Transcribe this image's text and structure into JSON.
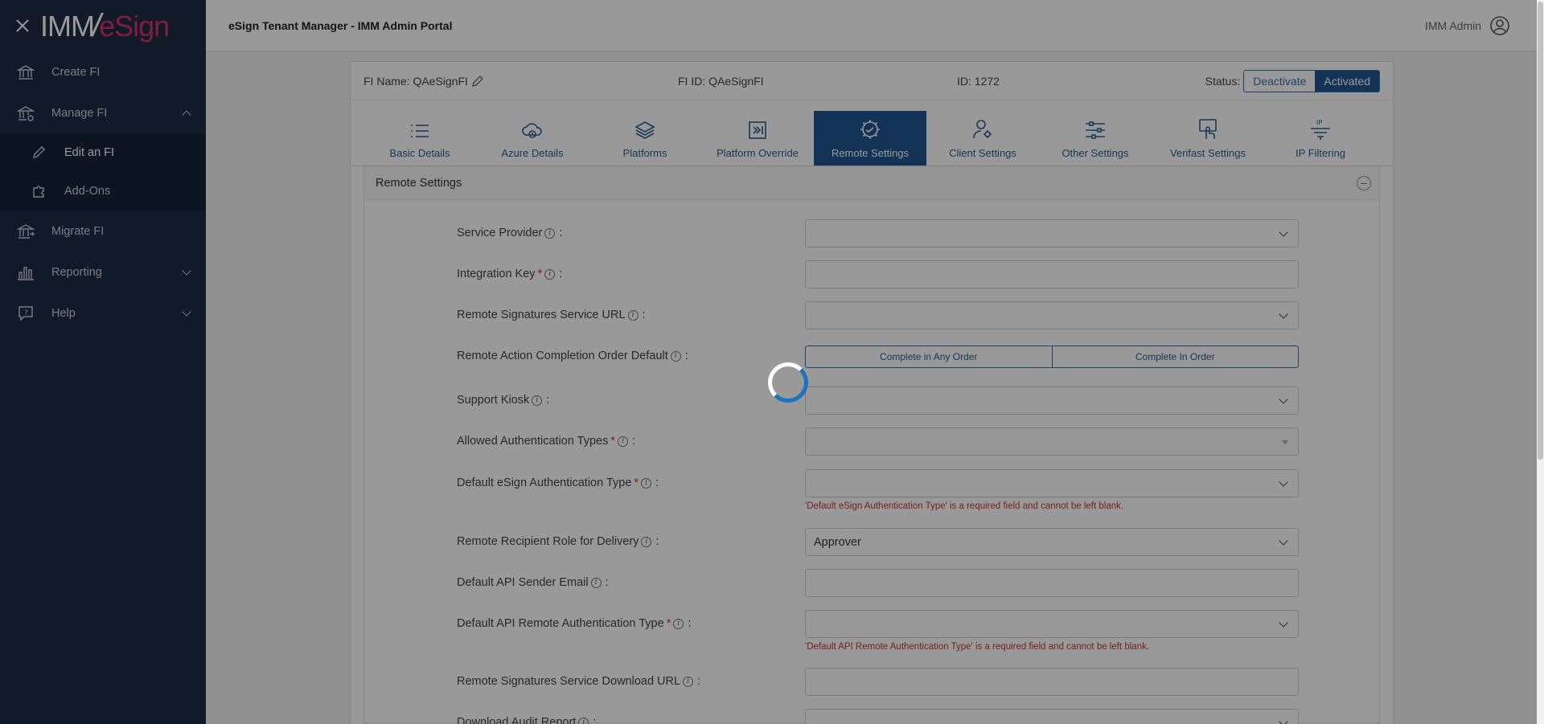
{
  "logo": {
    "part1": "IMM",
    "slash": "/",
    "part2": "eSign"
  },
  "sidebar": {
    "items": [
      {
        "label": "Create FI",
        "icon": "bank-icon"
      },
      {
        "label": "Manage FI",
        "icon": "bank-gear-icon",
        "expanded": true,
        "children": [
          {
            "label": "Edit an FI",
            "icon": "pencil-icon"
          },
          {
            "label": "Add-Ons",
            "icon": "puzzle-icon"
          }
        ]
      },
      {
        "label": "Migrate FI",
        "icon": "bank-arrow-icon"
      },
      {
        "label": "Reporting",
        "icon": "bar-chart-icon",
        "expanded": false
      },
      {
        "label": "Help",
        "icon": "help-bubble-icon",
        "expanded": false
      }
    ]
  },
  "header": {
    "title": "eSign Tenant Manager - IMM Admin Portal",
    "user": "IMM Admin"
  },
  "fi": {
    "name_label": "FI Name: QAeSignFI",
    "id_label": "FI ID: QAeSignFI",
    "num_id_label": "ID: 1272",
    "status_label": "Status:",
    "deactivate": "Deactivate",
    "activated": "Activated"
  },
  "tabs": [
    {
      "label": "Basic Details",
      "icon": "list-icon"
    },
    {
      "label": "Azure Details",
      "icon": "cloud-icon"
    },
    {
      "label": "Platforms",
      "icon": "layers-icon"
    },
    {
      "label": "Platform Override",
      "icon": "override-icon"
    },
    {
      "label": "Remote Settings",
      "icon": "remote-gear-icon",
      "active": true
    },
    {
      "label": "Client Settings",
      "icon": "user-gear-icon"
    },
    {
      "label": "Other Settings",
      "icon": "sliders-icon"
    },
    {
      "label": "Verifast Settings",
      "icon": "hand-touch-icon"
    },
    {
      "label": "IP Filtering",
      "icon": "ip-filter-icon"
    }
  ],
  "section": {
    "title": "Remote Settings"
  },
  "form": {
    "service_provider": {
      "label": "Service Provider",
      "value": ""
    },
    "integration_key": {
      "label": "Integration Key",
      "value": ""
    },
    "remote_sig_url": {
      "label": "Remote Signatures Service URL",
      "value": ""
    },
    "completion_order": {
      "label": "Remote Action Completion Order Default",
      "opt1": "Complete in Any Order",
      "opt2": "Complete In Order"
    },
    "support_kiosk": {
      "label": "Support Kiosk",
      "value": ""
    },
    "allowed_auth": {
      "label": "Allowed Authentication Types",
      "value": ""
    },
    "default_esign_auth": {
      "label": "Default eSign Authentication Type",
      "value": "",
      "error": "'Default eSign Authentication Type' is a required field and cannot be left blank."
    },
    "recipient_role": {
      "label": "Remote Recipient Role for Delivery",
      "value": "Approver"
    },
    "api_sender_email": {
      "label": "Default API Sender Email",
      "value": ""
    },
    "api_remote_auth": {
      "label": "Default API Remote Authentication Type",
      "value": "",
      "error": "'Default API Remote Authentication Type' is a required field and cannot be left blank."
    },
    "download_url": {
      "label": "Remote Signatures Service Download URL",
      "value": ""
    },
    "download_audit": {
      "label": "Download Audit Report",
      "value": ""
    }
  },
  "symbols": {
    "required": "*",
    "info": "i",
    "colon": ":"
  },
  "colors": {
    "sidebar": "#1e2a44",
    "primary": "#1f5690",
    "error": "#c0392b",
    "brand_pink": "#d1336a"
  }
}
